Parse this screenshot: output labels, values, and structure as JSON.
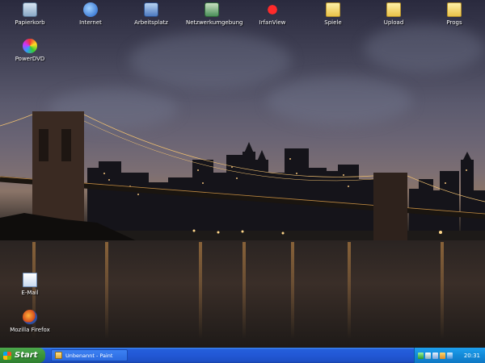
{
  "desktop": {
    "icons_top": [
      {
        "label": "Papierkorb",
        "icon": "recycle-bin-icon"
      },
      {
        "label": "Internet",
        "icon": "internet-explorer-icon"
      },
      {
        "label": "Arbeitsplatz",
        "icon": "my-computer-icon"
      },
      {
        "label": "Netzwerkumgebung",
        "icon": "network-icon"
      },
      {
        "label": "IrfanView",
        "icon": "irfanview-icon"
      },
      {
        "label": "Spiele",
        "icon": "folder-icon"
      },
      {
        "label": "Upload",
        "icon": "folder-icon"
      },
      {
        "label": "Progs",
        "icon": "folder-icon"
      }
    ],
    "icon_powerdvd": {
      "label": "PowerDVD",
      "icon": "powerdvd-icon"
    },
    "icon_email": {
      "label": "E-Mail",
      "icon": "email-icon"
    },
    "icon_firefox": {
      "label": "Mozilla Firefox",
      "icon": "firefox-icon"
    }
  },
  "taskbar": {
    "start_label": "Start",
    "task_paint_label": "Unbenannt - Paint",
    "clock": "20:31"
  },
  "colors": {
    "taskbar_blue": "#245edb",
    "start_green": "#3a953a",
    "tray_blue": "#128ad8"
  }
}
